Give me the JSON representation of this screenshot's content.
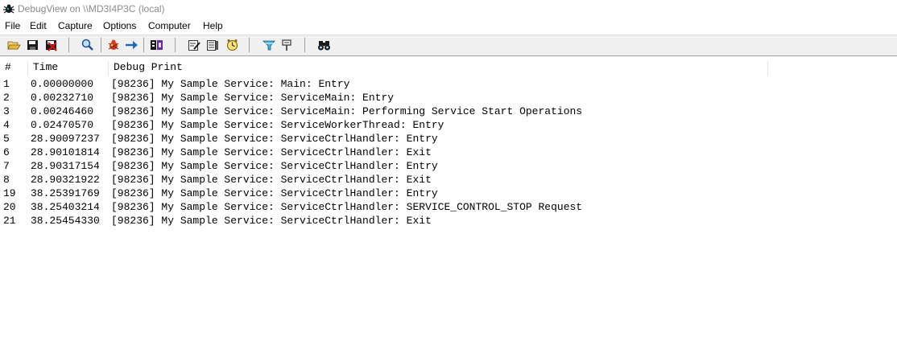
{
  "window": {
    "title": "DebugView on \\\\MD3I4P3C (local)"
  },
  "menu": [
    "File",
    "Edit",
    "Capture",
    "Options",
    "Computer",
    "Help"
  ],
  "toolbar": {
    "icons": [
      "open-icon",
      "save-icon",
      "clear-display-icon",
      "find-icon",
      "capture-icon",
      "autoscroll-icon",
      "filter-icon",
      "edit-icon",
      "history-icon",
      "clock-time-icon",
      "highlight-icon",
      "pin-icon",
      "binoculars-icon"
    ]
  },
  "columns": {
    "num": "#",
    "time": "Time",
    "message": "Debug Print"
  },
  "rows": [
    {
      "num": "1",
      "time": "0.00000000",
      "message": "[98236] My Sample Service: Main: Entry"
    },
    {
      "num": "2",
      "time": "0.00232710",
      "message": "[98236] My Sample Service: ServiceMain: Entry"
    },
    {
      "num": "3",
      "time": "0.00246460",
      "message": "[98236] My Sample Service: ServiceMain: Performing Service Start Operations"
    },
    {
      "num": "4",
      "time": "0.02470570",
      "message": "[98236] My Sample Service: ServiceWorkerThread: Entry"
    },
    {
      "num": "5",
      "time": "28.90097237",
      "message": "[98236] My Sample Service: ServiceCtrlHandler: Entry"
    },
    {
      "num": "6",
      "time": "28.90101814",
      "message": "[98236] My Sample Service: ServiceCtrlHandler: Exit"
    },
    {
      "num": "7",
      "time": "28.90317154",
      "message": "[98236] My Sample Service: ServiceCtrlHandler: Entry"
    },
    {
      "num": "8",
      "time": "28.90321922",
      "message": "[98236] My Sample Service: ServiceCtrlHandler: Exit"
    },
    {
      "num": "19",
      "time": "38.25391769",
      "message": "[98236] My Sample Service: ServiceCtrlHandler: Entry"
    },
    {
      "num": "20",
      "time": "38.25403214",
      "message": "[98236] My Sample Service: ServiceCtrlHandler: SERVICE_CONTROL_STOP Request"
    },
    {
      "num": "21",
      "time": "38.25454330",
      "message": "[98236] My Sample Service: ServiceCtrlHandler: Exit"
    }
  ]
}
